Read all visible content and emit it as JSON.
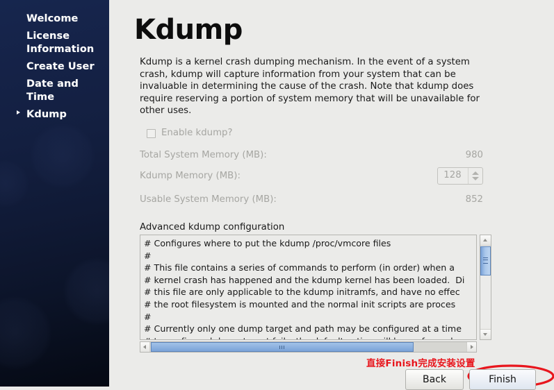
{
  "sidebar": {
    "items": [
      {
        "label": "Welcome",
        "selected": false
      },
      {
        "label": "License Information",
        "selected": false
      },
      {
        "label": "Create User",
        "selected": false
      },
      {
        "label": "Date and Time",
        "selected": false
      },
      {
        "label": "Kdump",
        "selected": true
      }
    ]
  },
  "main": {
    "title": "Kdump",
    "description": "Kdump is a kernel crash dumping mechanism. In the event of a system crash, kdump will capture information from your system that can be invaluable in determining the cause of the crash. Note that kdump does require reserving a portion of system memory that will be unavailable for other uses.",
    "enable_checkbox": {
      "label": "Enable kdump?",
      "checked": false
    },
    "fields": {
      "total_memory_label": "Total System Memory (MB):",
      "total_memory_value": "980",
      "kdump_memory_label": "Kdump Memory (MB):",
      "kdump_memory_value": "128",
      "usable_memory_label": "Usable System Memory (MB):",
      "usable_memory_value": "852"
    },
    "advanced": {
      "label": "Advanced kdump configuration",
      "content": "# Configures where to put the kdump /proc/vmcore files\n#\n# This file contains a series of commands to perform (in order) when a\n# kernel crash has happened and the kdump kernel has been loaded.  Di\n# this file are only applicable to the kdump initramfs, and have no effec\n# the root filesystem is mounted and the normal init scripts are proces\n#\n# Currently only one dump target and path may be configured at a time\n# to configured dump target fails, the default action will be preformed."
    }
  },
  "annotation": {
    "text": "直接Finish完成安装设置",
    "color": "#e8161d"
  },
  "footer": {
    "back_label": "Back",
    "finish_label": "Finish"
  }
}
